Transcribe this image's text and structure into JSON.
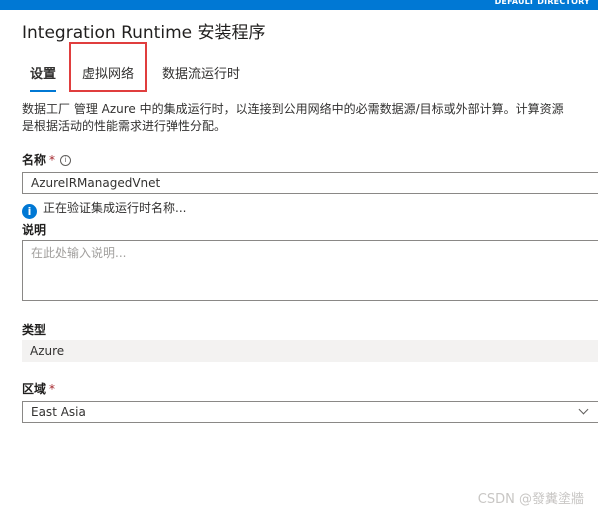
{
  "header": {
    "directory": "DEFAULT DIRECTORY",
    "title": "Integration Runtime 安装程序"
  },
  "tabs": [
    {
      "label": "设置",
      "active": true
    },
    {
      "label": "虚拟网络",
      "active": false,
      "highlighted": true
    },
    {
      "label": "数据流运行时",
      "active": false
    }
  ],
  "description": {
    "line1": "数据工厂 管理 Azure 中的集成运行时，以连接到公用网络中的必需数据源/目标或外部计算。计算资源",
    "line2": "是根据活动的性能需求进行弹性分配。"
  },
  "name_field": {
    "label": "名称",
    "required_mark": "*",
    "info_icon": "i",
    "value": "AzureIRManagedVnet"
  },
  "validation": {
    "icon": "i",
    "text": "正在验证集成运行时名称..."
  },
  "description_field": {
    "label": "说明",
    "placeholder": "在此处输入说明..."
  },
  "type_field": {
    "label": "类型",
    "value": "Azure"
  },
  "region_field": {
    "label": "区域",
    "required_mark": "*",
    "value": "East Asia"
  },
  "watermark": "CSDN @發糞塗牆",
  "colors": {
    "accent": "#0078d4",
    "highlight_box": "#e03e3e",
    "required": "#a4262c"
  }
}
